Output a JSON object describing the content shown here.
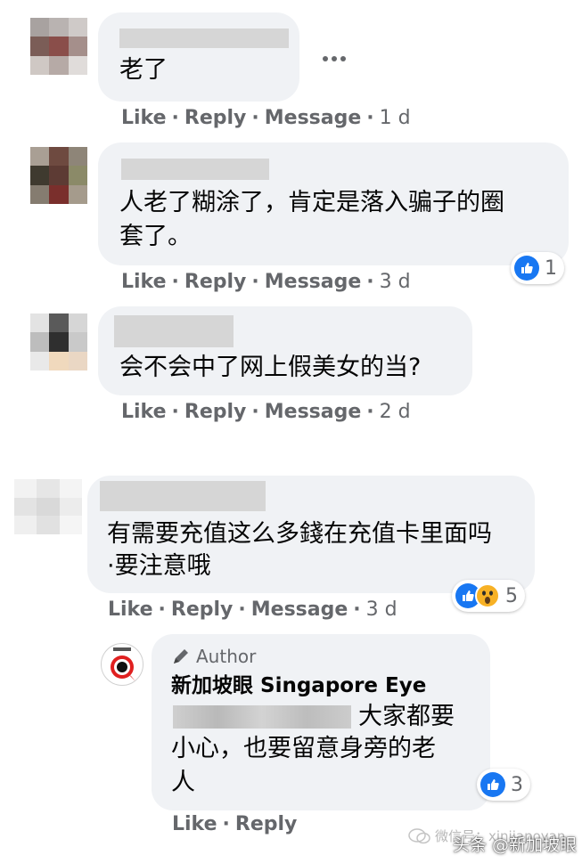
{
  "comments": [
    {
      "text": "老了",
      "actions": {
        "like": "Like",
        "reply": "Reply",
        "message": "Message",
        "time": "1 d"
      },
      "more_icon": "more-horizontal-icon"
    },
    {
      "text": "人老了糊涂了，肯定是落入骗子的圈套了。",
      "text_line1": "人老了糊涂了，肯定是落入骗子的圈",
      "text_line2": "套了。",
      "reaction_count": "1",
      "actions": {
        "like": "Like",
        "reply": "Reply",
        "message": "Message",
        "time": "3 d"
      }
    },
    {
      "text": "会不会中了网上假美女的当?",
      "actions": {
        "like": "Like",
        "reply": "Reply",
        "message": "Message",
        "time": "2 d"
      }
    },
    {
      "text": "有需要充值这么多錢在充值卡里面吗·要注意哦",
      "text_line1": "有需要充值这么多錢在充值卡里面吗",
      "text_line2": "·要注意哦",
      "reaction_count": "5",
      "actions": {
        "like": "Like",
        "reply": "Reply",
        "message": "Message",
        "time": "3 d"
      }
    }
  ],
  "reply": {
    "author_badge": "Author",
    "author_name": "新加坡眼 Singapore Eye",
    "text_line1": "大家都要",
    "text_line2": "小心，也要留意身旁的老",
    "text_line3": "人",
    "reaction_count": "3",
    "actions": {
      "like": "Like",
      "reply": "Reply"
    }
  },
  "watermark": {
    "wechat": "微信号：xinjiapoyan",
    "toutiao": "头条 @新加坡眼"
  },
  "colors": {
    "bubble": "#f0f2f5",
    "meta_text": "#65676b",
    "like_blue": "#1877f2",
    "wow_yellow": "#f7b125"
  }
}
